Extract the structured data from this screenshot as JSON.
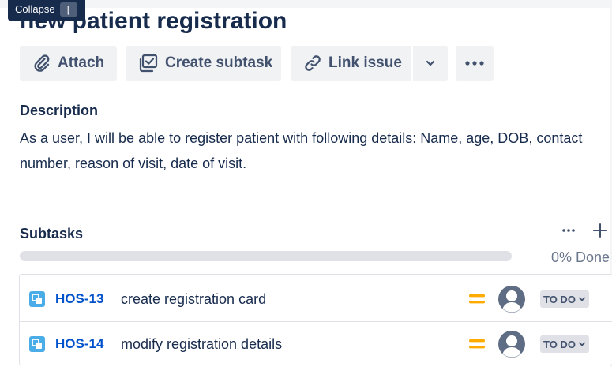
{
  "tooltip": {
    "label": "Collapse",
    "shortcut": "["
  },
  "issue": {
    "title": "new patient registration"
  },
  "toolbar": {
    "attach_label": "Attach",
    "create_subtask_label": "Create subtask",
    "link_issue_label": "Link issue"
  },
  "description": {
    "heading": "Description",
    "body": "As a user, I will be able to register patient with following details: Name, age, DOB, contact number, reason of visit, date of visit."
  },
  "subtasks": {
    "heading": "Subtasks",
    "progress_percent": 0,
    "progress_label": "0% Done",
    "items": [
      {
        "key": "HOS-13",
        "summary": "create registration card",
        "priority_icon": "priority-medium-icon",
        "status": "TO DO"
      },
      {
        "key": "HOS-14",
        "summary": "modify registration details",
        "priority_icon": "priority-medium-icon",
        "status": "TO DO"
      }
    ]
  },
  "colors": {
    "link": "#0052cc",
    "text": "#172b4d",
    "button_bg": "#f1f2f4",
    "priority_medium": "#ffab00",
    "subtask_icon": "#4bade8",
    "status_bg": "#dfe1e6"
  }
}
